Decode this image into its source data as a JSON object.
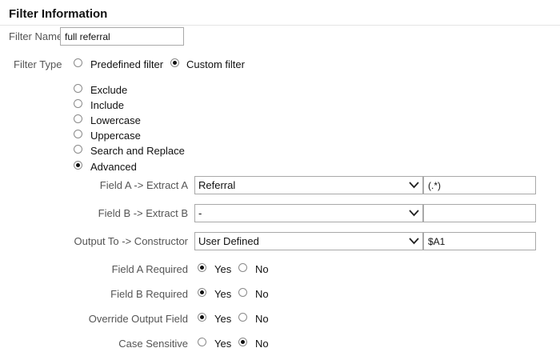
{
  "section": {
    "title": "Filter Information"
  },
  "filter_name": {
    "label": "Filter Name",
    "value": "full referral"
  },
  "filter_type": {
    "label": "Filter Type",
    "options": [
      {
        "label": "Predefined filter",
        "selected": false
      },
      {
        "label": "Custom filter",
        "selected": true
      }
    ]
  },
  "custom_filter": {
    "options": [
      {
        "label": "Exclude",
        "selected": false
      },
      {
        "label": "Include",
        "selected": false
      },
      {
        "label": "Lowercase",
        "selected": false
      },
      {
        "label": "Uppercase",
        "selected": false
      },
      {
        "label": "Search and Replace",
        "selected": false
      },
      {
        "label": "Advanced",
        "selected": true
      }
    ]
  },
  "advanced": {
    "field_a": {
      "label": "Field A -> Extract A",
      "select_value": "Referral",
      "input_value": "(.*)"
    },
    "field_b": {
      "label": "Field B -> Extract B",
      "select_value": "-",
      "input_value": ""
    },
    "output": {
      "label": "Output To -> Constructor",
      "select_value": "User Defined",
      "input_value": "$A1"
    },
    "toggles": [
      {
        "label": "Field A Required",
        "yes": "Yes",
        "no": "No",
        "value": "yes"
      },
      {
        "label": "Field B Required",
        "yes": "Yes",
        "no": "No",
        "value": "yes"
      },
      {
        "label": "Override Output Field",
        "yes": "Yes",
        "no": "No",
        "value": "yes"
      },
      {
        "label": "Case Sensitive",
        "yes": "Yes",
        "no": "No",
        "value": "no"
      }
    ]
  },
  "icons": {
    "select_arrow": "chevron-down-icon",
    "radio": "radio-button-icon"
  }
}
